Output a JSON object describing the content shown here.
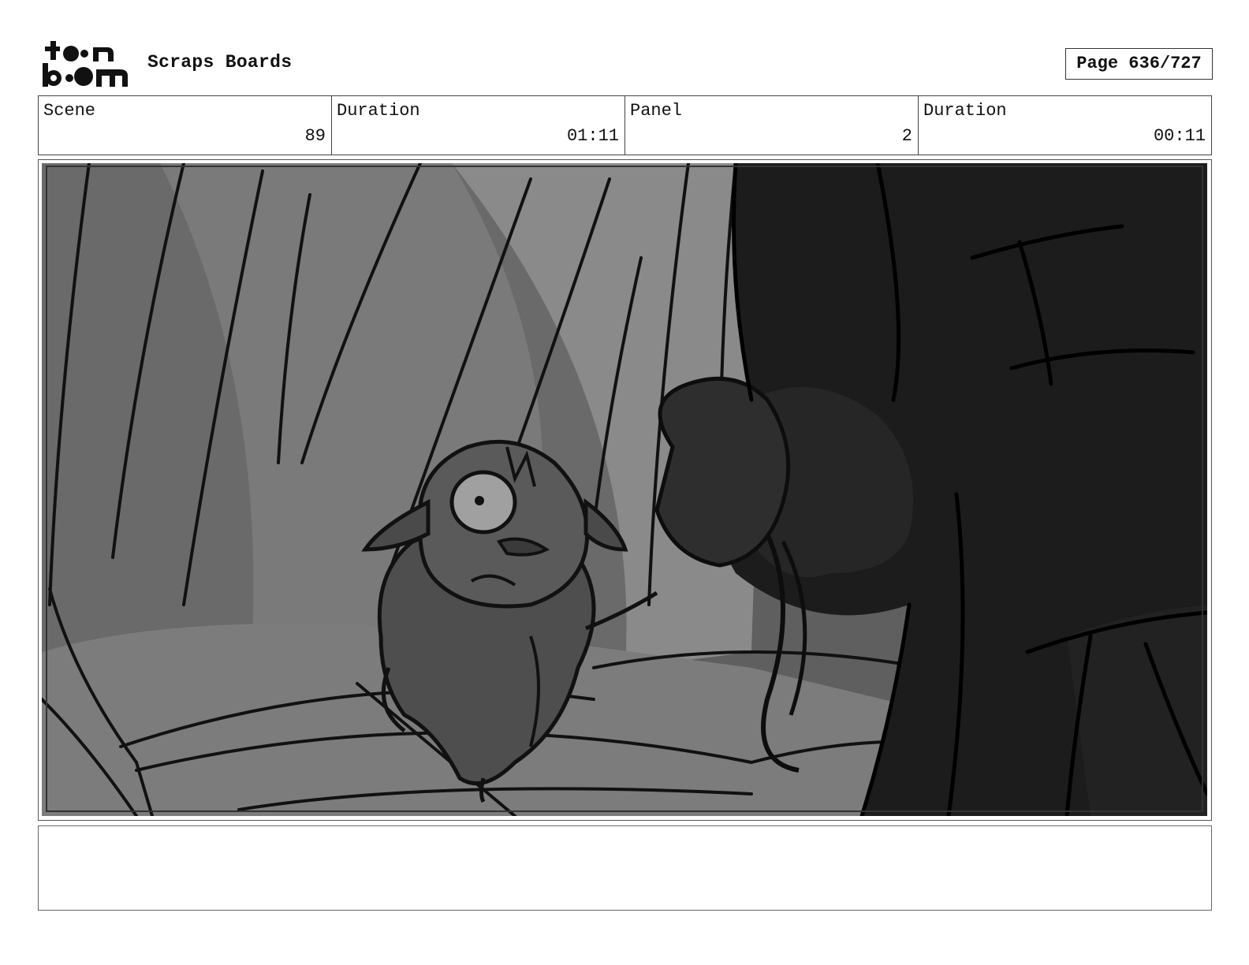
{
  "header": {
    "logo_text": "toonboom",
    "board_title": "Scraps Boards",
    "page_label": "Page 636/727"
  },
  "info": {
    "scene_label": "Scene",
    "scene_value": "89",
    "scene_duration_label": "Duration",
    "scene_duration_value": "01:11",
    "panel_label": "Panel",
    "panel_value": "2",
    "panel_duration_label": "Duration",
    "panel_duration_value": "00:11"
  },
  "panel": {
    "image_icon": "storyboard-sketch-dog-and-figure"
  },
  "notes": {
    "text": ""
  },
  "colors": {
    "border": "#444444",
    "sketch_dark": "#1a1a1a",
    "sketch_mid": "#6b6b6b",
    "sketch_light": "#8e8e8e"
  }
}
